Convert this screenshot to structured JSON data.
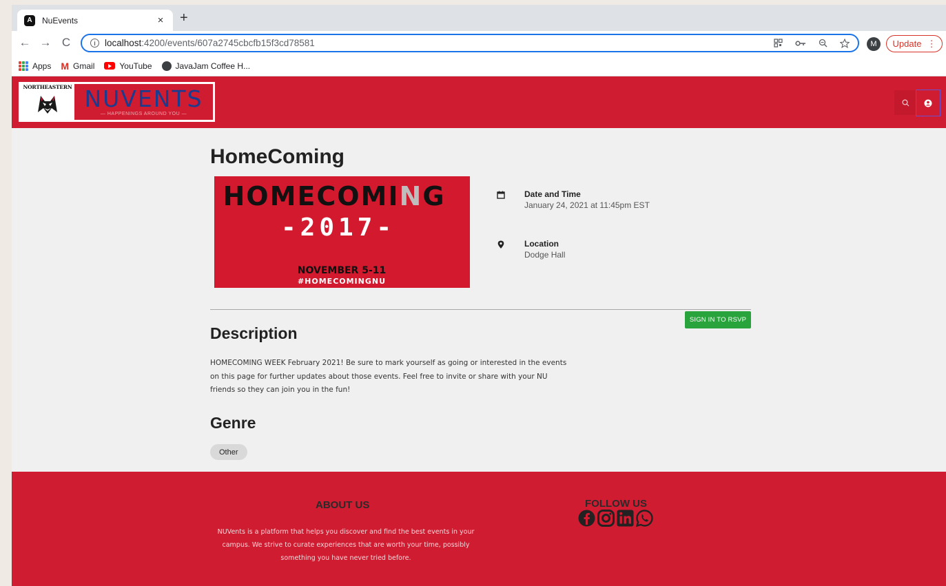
{
  "browser": {
    "tab": {
      "title": "NuEvents",
      "favicon_letter": "A",
      "close": "×"
    },
    "new_tab": "+",
    "toolbar": {
      "back": "←",
      "forward": "→",
      "reload": "C",
      "url_host": "localhost",
      "url_path": ":4200/events/607a2745cbcfb15f3cd78581",
      "avatar_letter": "M",
      "update_label": "Update",
      "menu_dots": "⋮"
    },
    "bookmarks": [
      {
        "label": "Apps",
        "icon": "apps-icon"
      },
      {
        "label": "Gmail",
        "icon": "gmail-icon"
      },
      {
        "label": "YouTube",
        "icon": "youtube-icon"
      },
      {
        "label": "JavaJam Coffee H...",
        "icon": "globe-icon"
      }
    ]
  },
  "header": {
    "logo_school": "NORTHEASTERN",
    "logo_title": "NUVENTS",
    "logo_tagline": "— HAPPENINGS AROUND YOU —",
    "search_icon": "search-icon",
    "user_icon": "account-circle-icon"
  },
  "event": {
    "title": "HomeComing",
    "banner": {
      "line1_a": "HOMECOMI",
      "line1_n": "N",
      "line1_b": "G",
      "line2": "-2017-",
      "line3": "NOVEMBER 5-11",
      "line4": "#HOMECOMINGNU"
    },
    "date_label": "Date and Time",
    "date_value": "January 24, 2021 at 11:45pm EST",
    "location_label": "Location",
    "location_value": "Dodge Hall",
    "rsvp_label": "SIGN IN TO RSVP",
    "description_heading": "Description",
    "description_text": "HOMECOMING WEEK February 2021! Be sure to mark yourself as going or interested in the events on this page for further updates about those events. Feel free to invite or share with your NU friends so they can join you in the fun!",
    "genre_heading": "Genre",
    "genre_tag": "Other"
  },
  "footer": {
    "about_title": "ABOUT US",
    "about_text": "NUVents is a platform that helps you discover and find the best events in your campus. We strive to curate experiences that are worth your time, possibly something you have never tried before.",
    "follow_title": "FOLLOW US",
    "social": [
      "facebook-icon",
      "instagram-icon",
      "linkedin-icon",
      "whatsapp-icon"
    ]
  },
  "colors": {
    "brand_red": "#d01c31",
    "navy": "#1b3c8e",
    "rsvp_green": "#29a33b",
    "chrome_focus_blue": "#1a73e8"
  }
}
